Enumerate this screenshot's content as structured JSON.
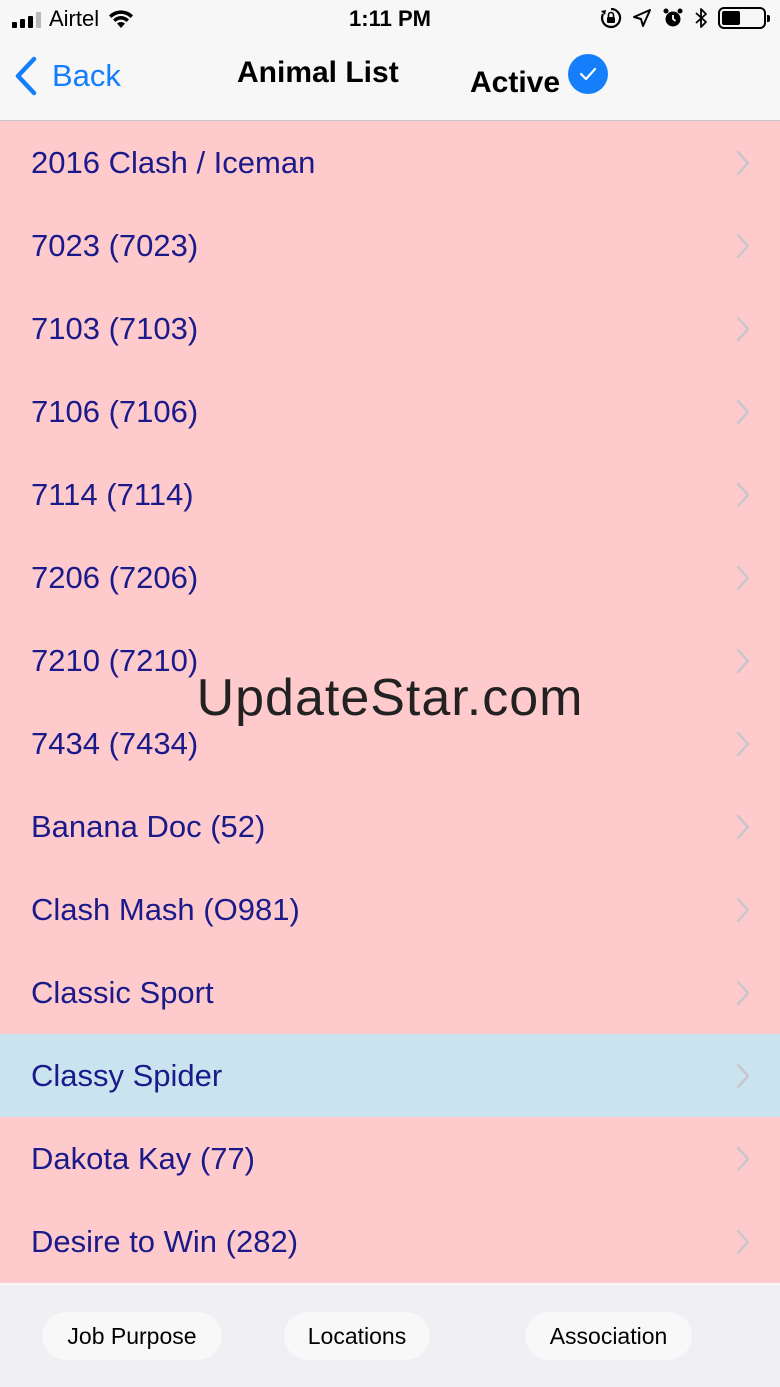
{
  "status_bar": {
    "carrier": "Airtel",
    "time": "1:11 PM",
    "icons": [
      "signal-icon",
      "wifi-icon",
      "orientation-lock-icon",
      "location-arrow-icon",
      "alarm-icon",
      "bluetooth-icon",
      "battery-icon"
    ],
    "battery_level": 0.45
  },
  "nav": {
    "back_label": "Back",
    "title": "Animal List",
    "active_label": "Active",
    "active_checked": true,
    "accent_color": "#147efb"
  },
  "list": {
    "row_color": "#fecacb",
    "highlight_color": "#c9e4ef",
    "text_color": "#1a1a8a",
    "items": [
      {
        "label": "2016 Clash / Iceman"
      },
      {
        "label": "7023 (7023)"
      },
      {
        "label": "7103 (7103)"
      },
      {
        "label": "7106 (7106)"
      },
      {
        "label": "7114 (7114)"
      },
      {
        "label": "7206 (7206)"
      },
      {
        "label": "7210 (7210)"
      },
      {
        "label": "7434 (7434)"
      },
      {
        "label": "Banana Doc (52)"
      },
      {
        "label": "Clash Mash (O981)"
      },
      {
        "label": "Classic Sport"
      },
      {
        "label": "Classy Spider",
        "highlighted": true
      },
      {
        "label": "Dakota Kay (77)"
      },
      {
        "label": "Desire to Win (282)"
      }
    ]
  },
  "watermark": "UpdateStar.com",
  "bottom_bar": {
    "job_purpose": "Job Purpose",
    "locations": "Locations",
    "association": "Association"
  }
}
